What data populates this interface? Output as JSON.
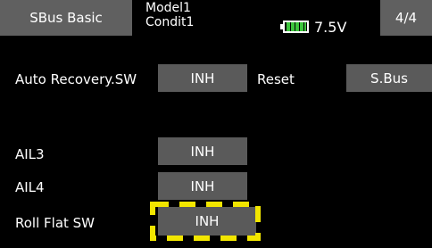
{
  "header": {
    "title": "SBus Basic",
    "model": "Model1",
    "condition": "Condit1",
    "voltage": "7.5V",
    "page": "4/4",
    "battery_color": "#3ec63e",
    "battery_icon": "battery-icon"
  },
  "rows": {
    "auto_recovery": {
      "label": "Auto Recovery.SW",
      "value": "INH"
    },
    "reset": {
      "label": "Reset",
      "value": "S.Bus"
    },
    "ail3": {
      "label": "AIL3",
      "value": "INH"
    },
    "ail4": {
      "label": "AIL4",
      "value": "INH"
    },
    "roll_flat": {
      "label": "Roll Flat SW",
      "value": "INH"
    }
  },
  "selection": {
    "row": "roll_flat",
    "highlight_color": "#f2e600"
  }
}
